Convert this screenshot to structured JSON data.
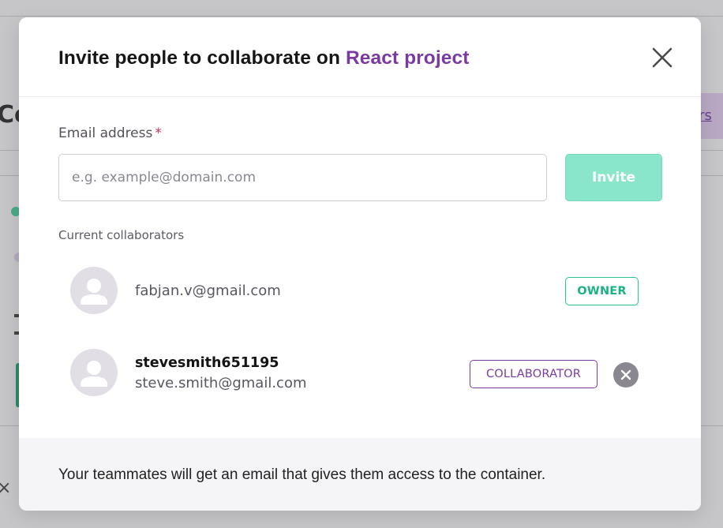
{
  "background": {
    "title_fragment": "Co",
    "link_fragment": "ers"
  },
  "modal": {
    "title_prefix": "Invite people to collaborate on ",
    "project_name": "React project",
    "close_icon": "close-icon",
    "email_label": "Email address",
    "required_marker": "*",
    "email_input": {
      "value": "",
      "placeholder": "e.g. example@domain.com"
    },
    "invite_button_label": "Invite",
    "collaborators_heading": "Current collaborators",
    "collaborators": [
      {
        "username": "",
        "email": "fabjan.v@gmail.com",
        "role": "OWNER",
        "removable": false
      },
      {
        "username": "stevesmith651195",
        "email": "steve.smith@gmail.com",
        "role": "COLLABORATOR",
        "removable": true
      }
    ],
    "footer_text": "Your teammates will get an email that gives them access to the container."
  },
  "colors": {
    "accent_purple": "#7b3aa0",
    "invite_button": "#8ae6cb",
    "owner_badge": "#19b384",
    "required": "#d2325a"
  }
}
